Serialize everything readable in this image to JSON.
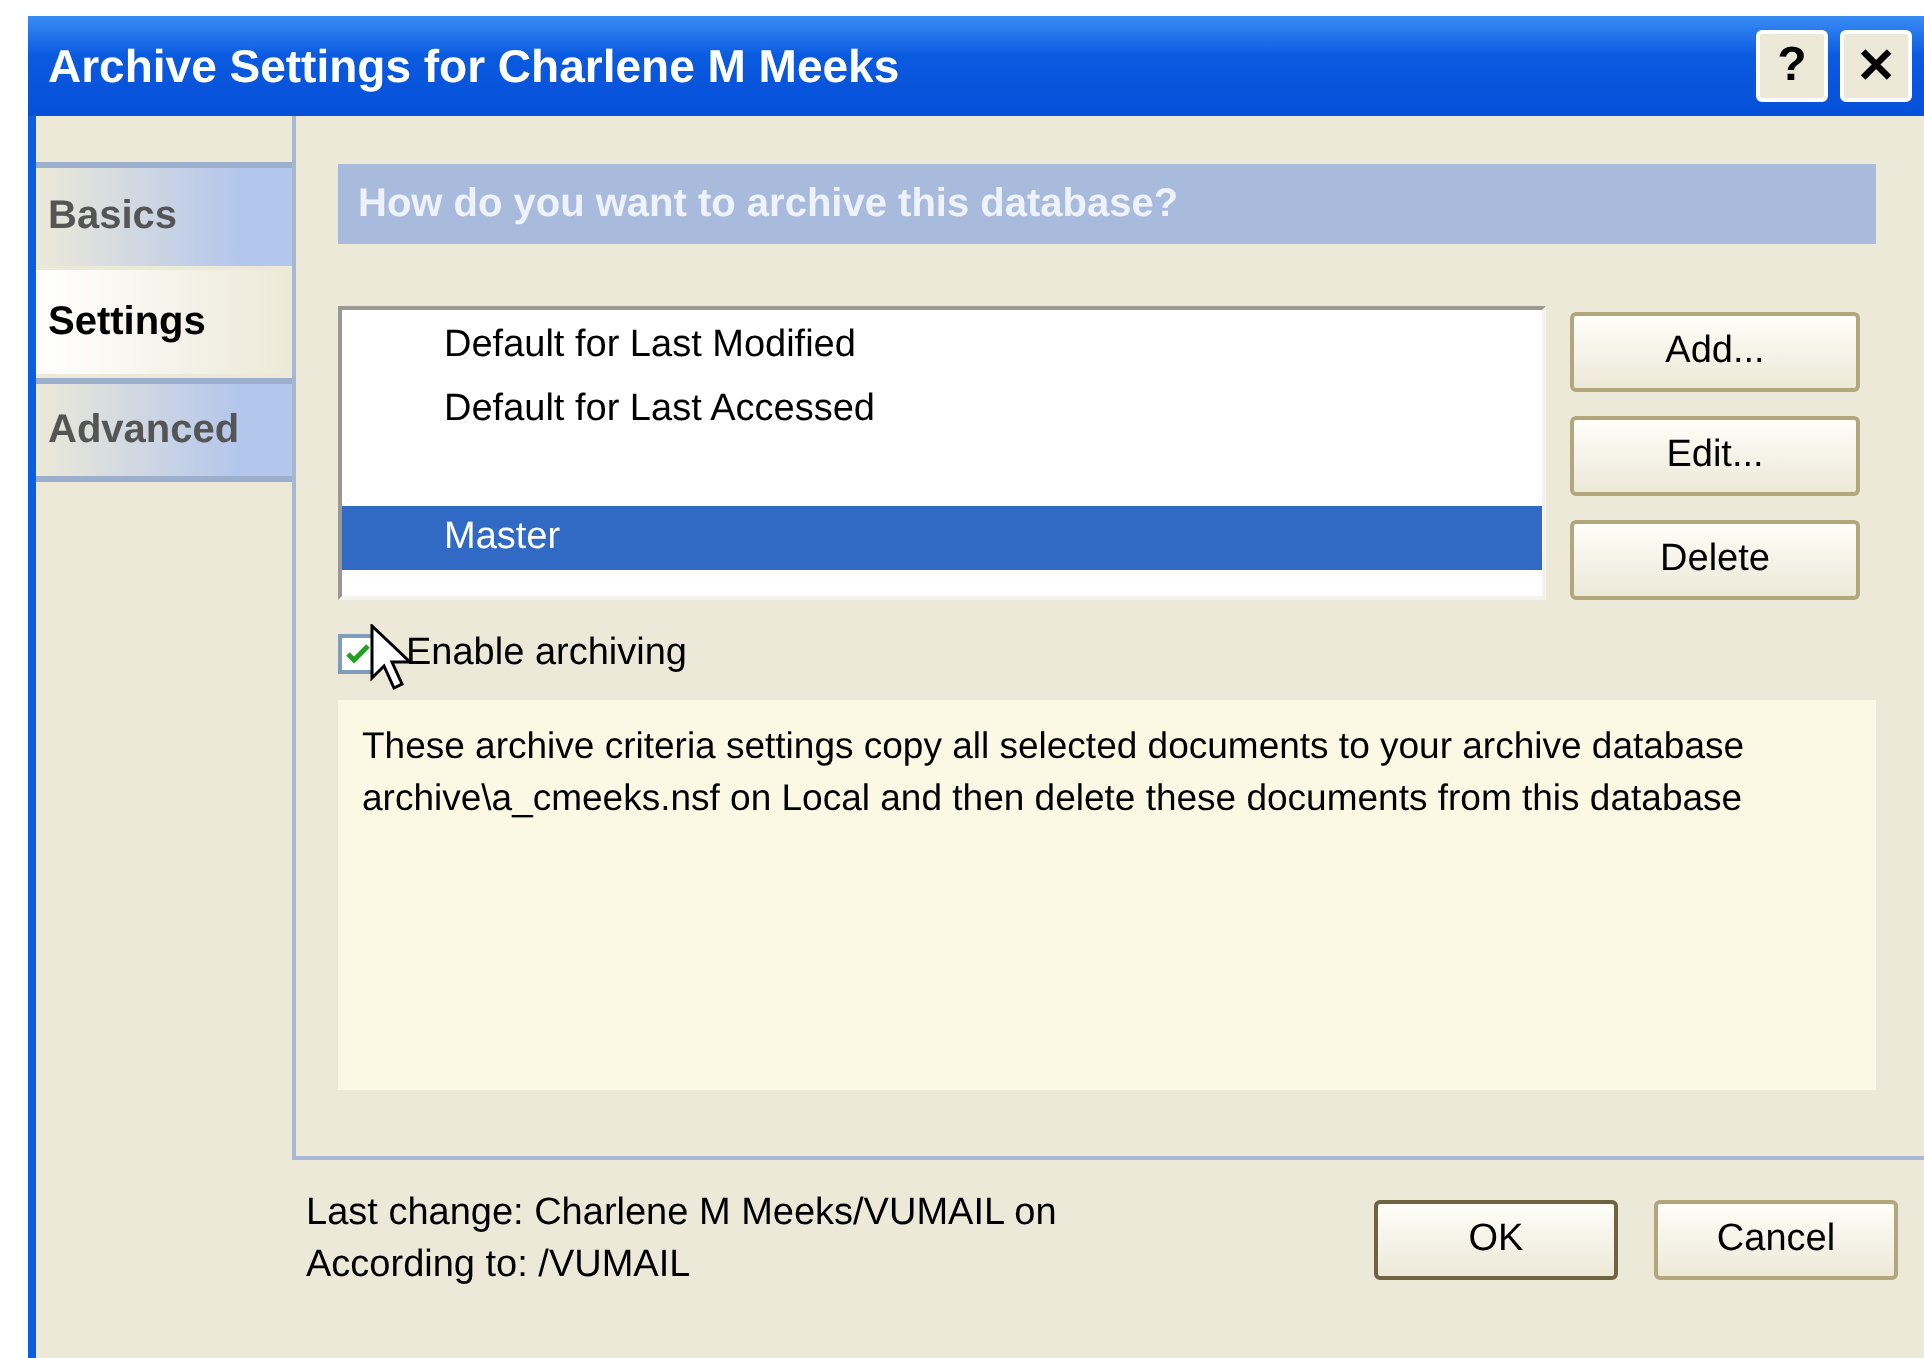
{
  "window": {
    "title": "Archive Settings for Charlene M Meeks",
    "help_button": "?",
    "close_button": "✕"
  },
  "tabs": [
    {
      "label": "Basics",
      "selected": false
    },
    {
      "label": "Settings",
      "selected": true
    },
    {
      "label": "Advanced",
      "selected": false
    }
  ],
  "header": "How do you want to archive this database?",
  "criteria": [
    {
      "label": "Default for Last Modified",
      "selected": false
    },
    {
      "label": "Default for Last Accessed",
      "selected": false
    },
    {
      "label": "Master",
      "selected": true
    }
  ],
  "criteria_buttons": [
    "Add...",
    "Edit...",
    "Delete"
  ],
  "enable_archiving": {
    "label": "Enable archiving",
    "checked": true
  },
  "description": "These archive criteria settings copy all selected documents to your archive database archive\\a_cmeeks.nsf on Local and then delete these documents from this database",
  "footer": {
    "last_change": "Last change: Charlene M Meeks/VUMAIL on",
    "according_to": "According to: /VUMAIL"
  },
  "buttons": [
    "OK",
    "Cancel"
  ]
}
